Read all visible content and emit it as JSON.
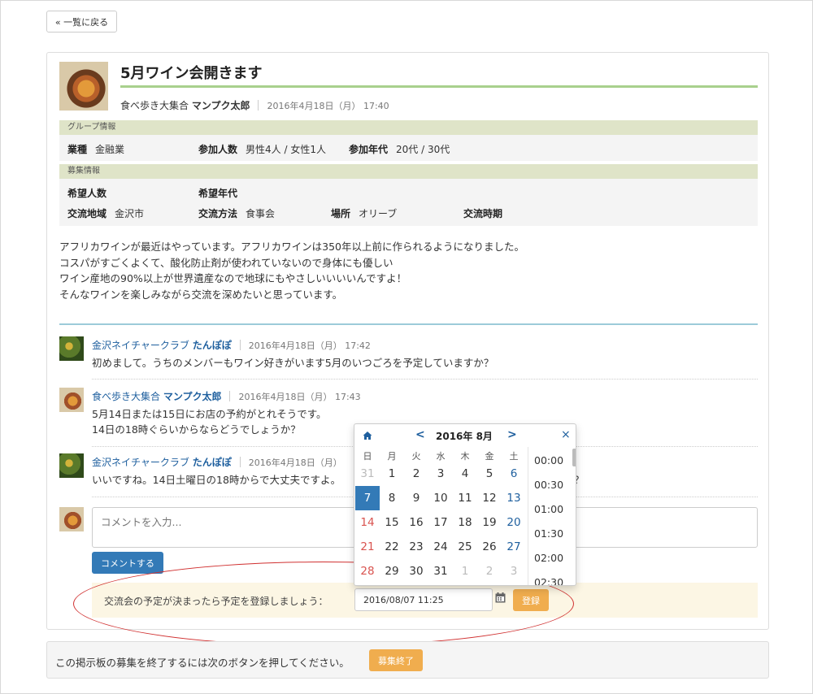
{
  "back_button": "« 一覧に戻る",
  "post": {
    "title": "5月ワイン会開きます",
    "group": "食べ歩き大集合",
    "author": "マンプク太郎",
    "date": "2016年4月18日（月） 17:40"
  },
  "group_info": {
    "heading": "グループ情報",
    "industry_label": "業種",
    "industry": "金融業",
    "members_label": "参加人数",
    "members": "男性4人 / 女性1人",
    "ages_label": "参加年代",
    "ages": "20代 / 30代"
  },
  "recruit_info": {
    "heading": "募集情報",
    "wanted_count_label": "希望人数",
    "wanted_count": "",
    "wanted_age_label": "希望年代",
    "wanted_age": "",
    "area_label": "交流地域",
    "area": "金沢市",
    "method_label": "交流方法",
    "method": "食事会",
    "place_label": "場所",
    "place": "オリーブ",
    "timing_label": "交流時期",
    "timing": ""
  },
  "description": [
    "アフリカワインが最近はやっています。アフリカワインは350年以上前に作られるようになりました。",
    "コスパがすごくよくて、酸化防止剤が使われていないので身体にも優しい",
    "ワイン産地の90%以上が世界遺産なので地球にもやさしいいいいんですよ！",
    "そんなワインを楽しみながら交流を深めたいと思っています。"
  ],
  "comments": [
    {
      "group": "金沢ネイチャークラブ",
      "author": "たんぽぽ",
      "date": "2016年4月18日（月） 17:42",
      "lines": [
        "初めまして。うちのメンバーもワイン好きがいます5月のいつごろを予定していますか？"
      ]
    },
    {
      "group": "食べ歩き大集合",
      "author": "マンプク太郎",
      "date": "2016年4月18日（月） 17:43",
      "lines": [
        "5月14日または15日にお店の予約がとれそうです。",
        "14日の18時ぐらいからならどうでしょうか？"
      ]
    },
    {
      "group": "金沢ネイチャークラブ",
      "author": "たんぽぽ",
      "date": "2016年4月18日（月）",
      "lines": [
        "いいですね。14日土曜日の18時からで大丈夫ですよ。"
      ],
      "trailing": "？"
    }
  ],
  "comment_form": {
    "placeholder": "コメントを入力...",
    "submit": "コメントする"
  },
  "schedule": {
    "label": "交流会の予定が決まったら予定を登録しましょう：",
    "value": "2016/08/07 11:25",
    "register": "登録"
  },
  "footer": {
    "text": "この掲示板の募集を終了するには次のボタンを押してください。",
    "button": "募集終了"
  },
  "picker": {
    "prev": "<",
    "next": ">",
    "close": "×",
    "title": "2016年 8月",
    "weekdays": [
      "日",
      "月",
      "火",
      "水",
      "木",
      "金",
      "土"
    ],
    "weeks": [
      [
        "31",
        "1",
        "2",
        "3",
        "4",
        "5",
        "6"
      ],
      [
        "7",
        "8",
        "9",
        "10",
        "11",
        "12",
        "13"
      ],
      [
        "14",
        "15",
        "16",
        "17",
        "18",
        "19",
        "20"
      ],
      [
        "21",
        "22",
        "23",
        "24",
        "25",
        "26",
        "27"
      ],
      [
        "28",
        "29",
        "30",
        "31",
        "1",
        "2",
        "3"
      ]
    ],
    "selected": "7",
    "times": [
      "00:00",
      "00:30",
      "01:00",
      "01:30",
      "02:00",
      "02:30"
    ]
  },
  "colors": {
    "accent": "#337ab7",
    "warning": "#f0ad4e",
    "sunday": "#d9534f",
    "saturday": "#1e5f9e",
    "ellipse": "#d03030"
  }
}
